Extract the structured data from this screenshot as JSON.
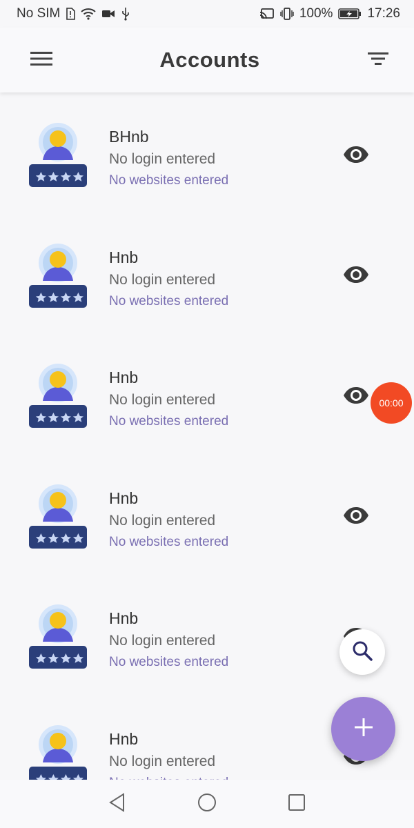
{
  "status_bar": {
    "carrier": "No SIM",
    "battery": "100%",
    "time": "17:26",
    "icons": [
      "sim-alert-icon",
      "wifi-icon",
      "video-camera-icon",
      "usb-icon",
      "cast-icon",
      "vibrate-icon",
      "battery-charging-icon"
    ]
  },
  "app_bar": {
    "title": "Accounts",
    "icons": [
      "menu-icon",
      "filter-icon"
    ]
  },
  "accounts": [
    {
      "name": "BHnb",
      "login": "No login entered",
      "websites": "No websites entered"
    },
    {
      "name": "Hnb",
      "login": "No login entered",
      "websites": "No websites entered"
    },
    {
      "name": "Hnb",
      "login": "No login entered",
      "websites": "No websites entered"
    },
    {
      "name": "Hnb",
      "login": "No login entered",
      "websites": "No websites entered"
    },
    {
      "name": "Hnb",
      "login": "No login entered",
      "websites": "No websites entered"
    },
    {
      "name": "Hnb",
      "login": "No login entered",
      "websites": "No websites entered"
    }
  ],
  "recording_badge": "00:00",
  "fabs": {
    "search_icon": "search-icon",
    "add_icon": "plus-icon"
  },
  "nav_bar": {
    "icons": [
      "back-icon",
      "home-icon",
      "recents-icon"
    ]
  },
  "colors": {
    "accent": "#9b80d6",
    "website_text": "#7a6fb2",
    "record_badge": "#f24a24",
    "background": "#f7f7f9"
  }
}
